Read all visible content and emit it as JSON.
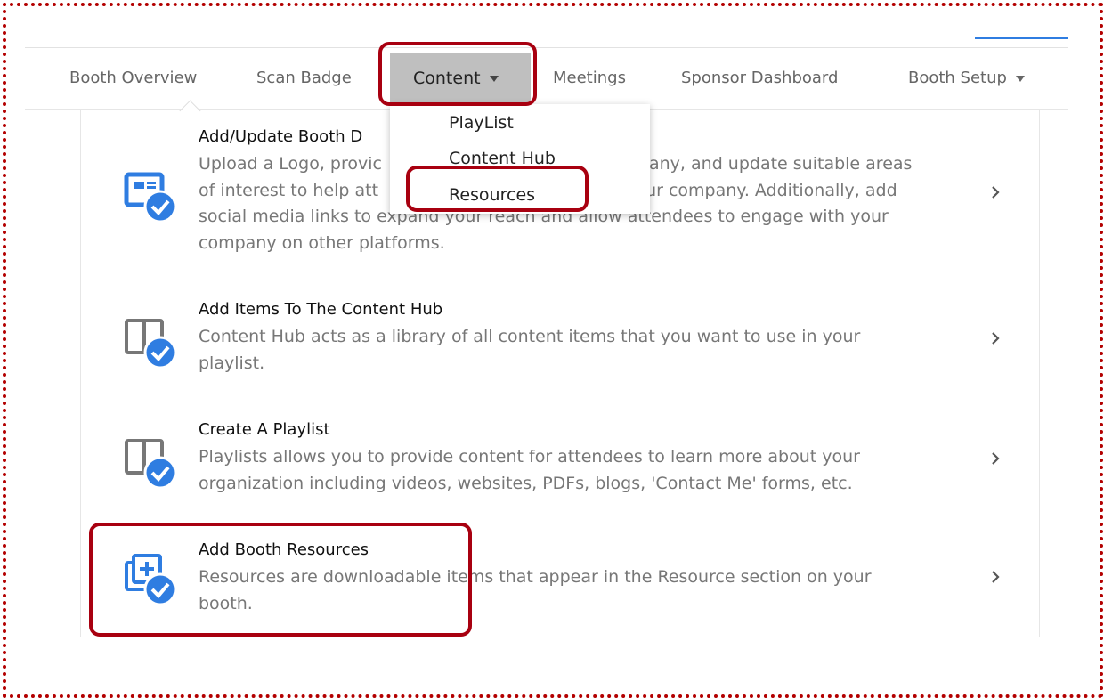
{
  "nav": {
    "items": [
      {
        "label": "Booth Overview"
      },
      {
        "label": "Scan Badge"
      },
      {
        "label": "Content"
      },
      {
        "label": "Meetings"
      },
      {
        "label": "Sponsor Dashboard"
      },
      {
        "label": "Booth Setup"
      }
    ],
    "content_dropdown": [
      "PlayList",
      "Content Hub",
      "Resources"
    ]
  },
  "cards": [
    {
      "title": "Add/Update Booth D",
      "desc_lines": [
        "Upload a Logo, provic",
        "of interest to help att",
        "social media links to expand your reach and allow attendees to engage with your",
        "company on other platforms."
      ],
      "desc_tail_1": "any, and update suitable areas",
      "desc_tail_2": "ur company. Additionally, add",
      "icon": "booth-details-check-icon"
    },
    {
      "title": "Add Items To The Content Hub",
      "desc_lines": [
        "Content Hub acts as a library of all content items that you want to use in your",
        "playlist."
      ],
      "icon": "content-hub-check-icon"
    },
    {
      "title": "Create A Playlist",
      "desc_lines": [
        "Playlists allows you to provide content for attendees to learn more about your",
        "organization including videos, websites, PDFs, blogs, 'Contact Me' forms, etc."
      ],
      "icon": "playlist-check-icon"
    },
    {
      "title": "Add Booth Resources",
      "desc_lines": [
        "Resources are downloadable items that appear in the Resource section on your",
        "booth."
      ],
      "icon": "resources-check-icon"
    }
  ],
  "colors": {
    "highlight": "#a80010",
    "accent_blue": "#2f7de1",
    "active_tab": "#bfbfbf"
  }
}
